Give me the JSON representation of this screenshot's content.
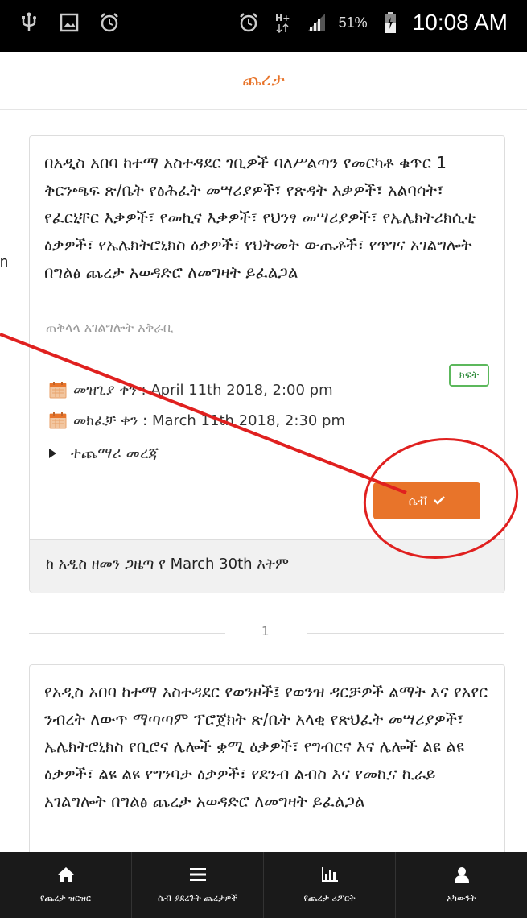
{
  "status_bar": {
    "battery": "51%",
    "time": "10:08 AM",
    "icons": [
      "usb-icon",
      "image-icon",
      "alarm-icon",
      "alarm-icon",
      "hplus-signal-icon",
      "signal-bars-icon",
      "battery-icon"
    ]
  },
  "header": {
    "title": "ጨረታ"
  },
  "tender1": {
    "description": "በአዲስ አበባ ከተማ አስተዳደር ገቢዎች ባለሥልጣን የመርካቶ ቁጥር 1 ቅርንጫፍ ጽ/ቤት የፅሕፈት መሣሪያዎች፣ የጽዳት እቃዎች፣ አልባሳት፣ የፈርኒቸር እቃዎች፣ የመኪና እቃዎች፣ የህንፃ መሣሪያዎች፣ የኤሌክትሪክሲቲ ዕቃዎች፣ የኤሌክትሮኒክስ ዕቃዎች፣ የህትመት ውጤቶች፣ የጥገና አገልግሎት በግልፅ ጨረታ አወዳድሮ ለመግዛት ይፈልጋል",
    "organization": "ጠቅላላ አገልግሎት አቅራቢ",
    "status_badge": "ክፍት",
    "closing_date": "መዝጊያ ቀን : April 11th 2018, 2:00 pm",
    "opening_date": "መክፈቻ ቀን : March 11th 2018, 2:30 pm",
    "more_info": "ተጨማሪ መረጃ",
    "save_label": "ሴቭ",
    "source": "ከ አዲስ ዘመን ጋዜጣ የ March 30th እትም"
  },
  "pagination": {
    "page": "1"
  },
  "tender2": {
    "description": "የአዲስ አበባ ከተማ አስተዳደር የወንዞች፤ የወንዝ ዳርቻዎች ልማት እና የአየር ንብረት ለውጥ ማጣጣም ፕሮጀክት ጽ/ቤት አላቂ የጽህፈት መሣሪያዎች፣ ኤሌክትሮኒክስ የቢሮና ሌሎች ቋሚ ዕቃዎች፣ የግብርና እና ሌሎች ልዩ ልዩ ዕቃዎች፣ ልዩ ልዩ የግንባታ ዕቃዎች፣ የደንብ ልብስ እና የመኪና ኪራይ አገልግሎት በግልፅ ጨረታ አወዳድሮ ለመግዛት ይፈልጋል"
  },
  "nav": [
    {
      "label": "የጨረታ ዝርዝር",
      "icon": "home-icon"
    },
    {
      "label": "ሴቭ ያደረጉት ጨረታዎች",
      "icon": "list-icon"
    },
    {
      "label": "የጨረታ ሪፖርት",
      "icon": "bar-chart-icon"
    },
    {
      "label": "አካውንት",
      "icon": "user-icon"
    }
  ],
  "colors": {
    "accent": "#e8742a",
    "open_badge": "#5cb85c",
    "annotation": "#e0201f"
  },
  "edge_text": "n"
}
